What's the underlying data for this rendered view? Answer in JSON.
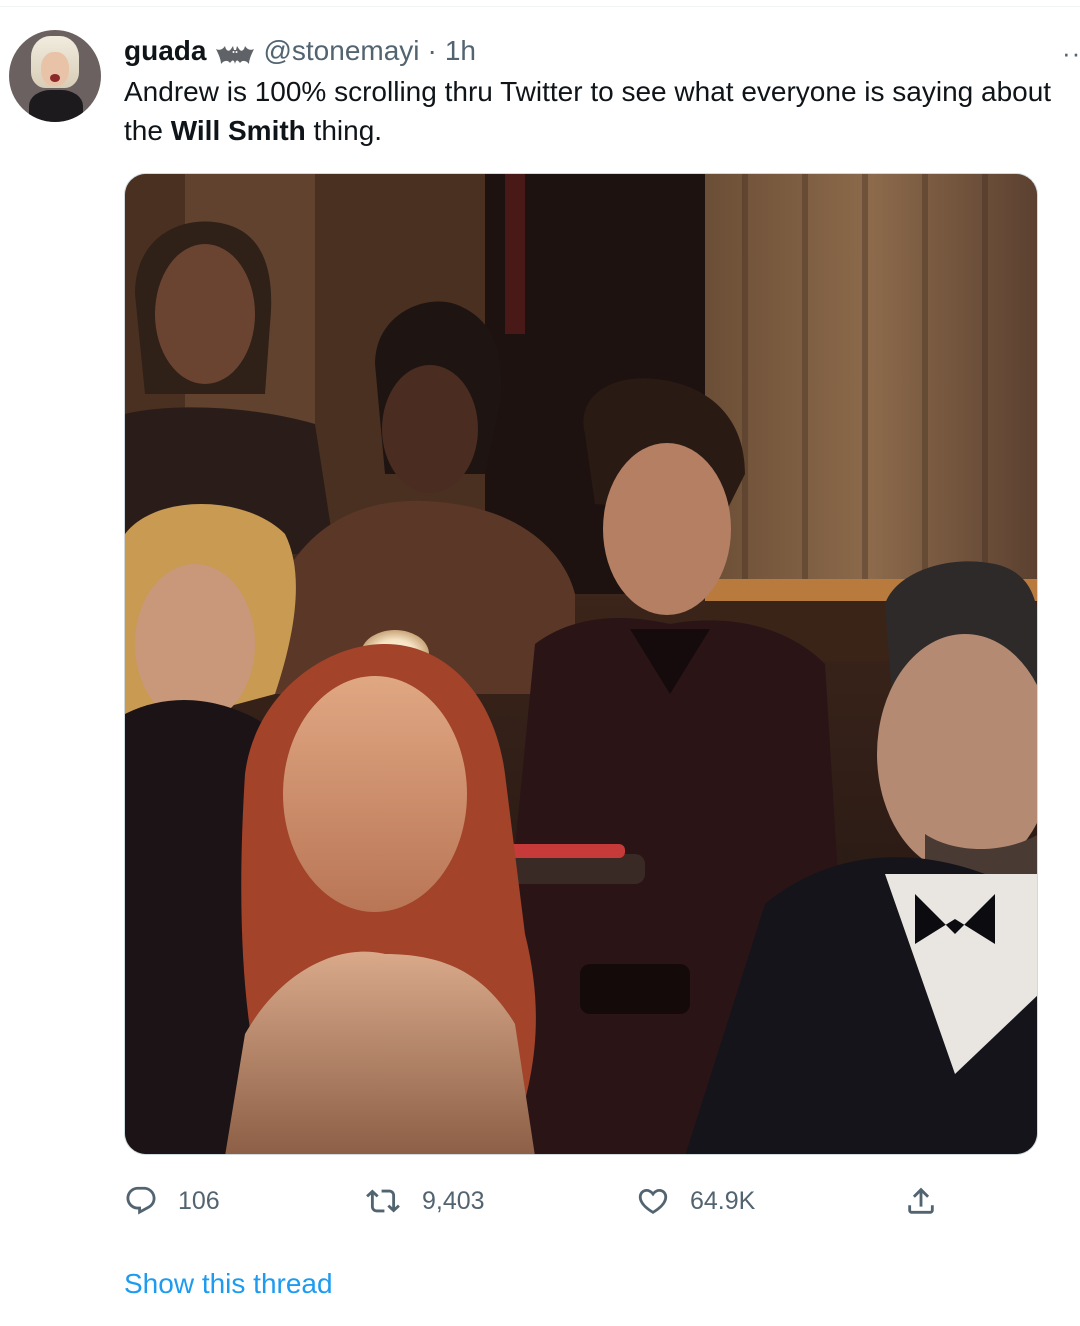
{
  "tweet": {
    "display_name": "guada",
    "badge_icon": "bat-emoji-icon",
    "handle": "@stonemayi",
    "separator": "·",
    "time": "1h",
    "more_label": "··",
    "text_line1": "Andrew is 100% scrolling thru Twitter to see what everyone is saying about",
    "text_line2_prefix": "the ",
    "text_line2_bold": "Will Smith",
    "text_line2_suffix": " thing.",
    "media_description_icon": "photo"
  },
  "actions": {
    "reply": {
      "icon": "reply-icon",
      "count": "106"
    },
    "retweet": {
      "icon": "retweet-icon",
      "count": "9,403"
    },
    "like": {
      "icon": "heart-icon",
      "count": "64.9K"
    },
    "share": {
      "icon": "share-icon"
    }
  },
  "footer": {
    "show_thread_label": "Show this thread"
  },
  "colors": {
    "text_primary": "#0f1419",
    "text_secondary": "#536471",
    "link": "#1d9bf0",
    "border": "#cfd9de"
  }
}
